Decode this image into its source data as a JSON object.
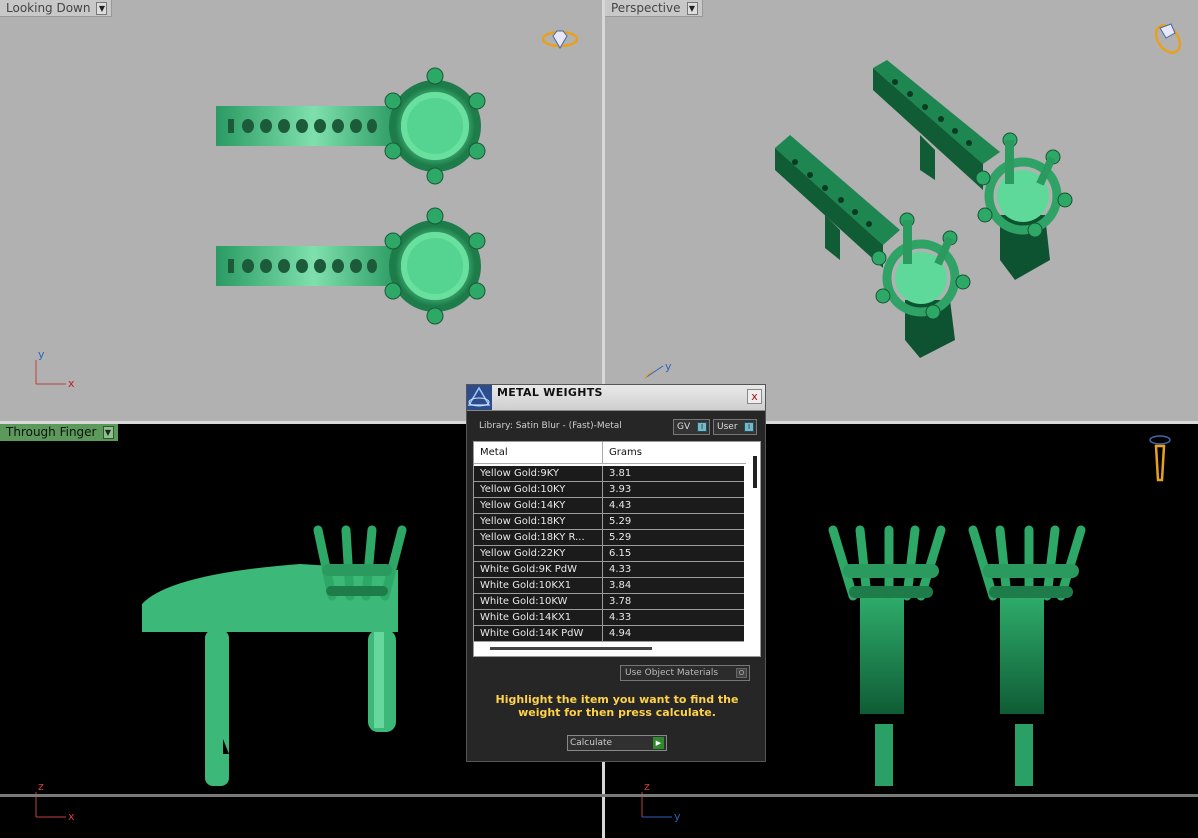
{
  "viewports": {
    "top_left": {
      "label": "Looking Down",
      "axis_a": "y",
      "axis_b": "x"
    },
    "top_right": {
      "label": "Perspective",
      "axis_a": "y"
    },
    "bottom_left": {
      "label": "Through Finger",
      "axis_a": "z",
      "axis_b": "x"
    },
    "bottom_right": {
      "axis_a": "z",
      "axis_b": "y"
    }
  },
  "dialog": {
    "title": "METAL WEIGHTS",
    "close_label": "x",
    "library_label": "Library: Satin Blur - (Fast)-Metal",
    "toggle_gv": "GV",
    "toggle_user": "User",
    "table": {
      "col_metal": "Metal",
      "col_grams": "Grams",
      "rows": [
        {
          "metal": "Yellow Gold:9KY",
          "grams": "3.81"
        },
        {
          "metal": "Yellow Gold:10KY",
          "grams": "3.93"
        },
        {
          "metal": "Yellow Gold:14KY",
          "grams": "4.43"
        },
        {
          "metal": "Yellow Gold:18KY",
          "grams": "5.29"
        },
        {
          "metal": "Yellow Gold:18KY R...",
          "grams": "5.29"
        },
        {
          "metal": "Yellow Gold:22KY",
          "grams": "6.15"
        },
        {
          "metal": "White Gold:9K PdW",
          "grams": "4.33"
        },
        {
          "metal": "White Gold:10KX1",
          "grams": "3.84"
        },
        {
          "metal": "White Gold:10KW",
          "grams": "3.78"
        },
        {
          "metal": "White Gold:14KX1",
          "grams": "4.33"
        },
        {
          "metal": "White Gold:14K PdW",
          "grams": "4.94"
        }
      ]
    },
    "use_object_materials": "Use Object Materials",
    "hint": "Highlight the item you want to find the weight for then press calculate.",
    "calculate_label": "Calculate"
  },
  "colors": {
    "model_green": "#3cb878",
    "model_dark": "#1f6e46",
    "hint_yellow": "#ffd24a"
  }
}
